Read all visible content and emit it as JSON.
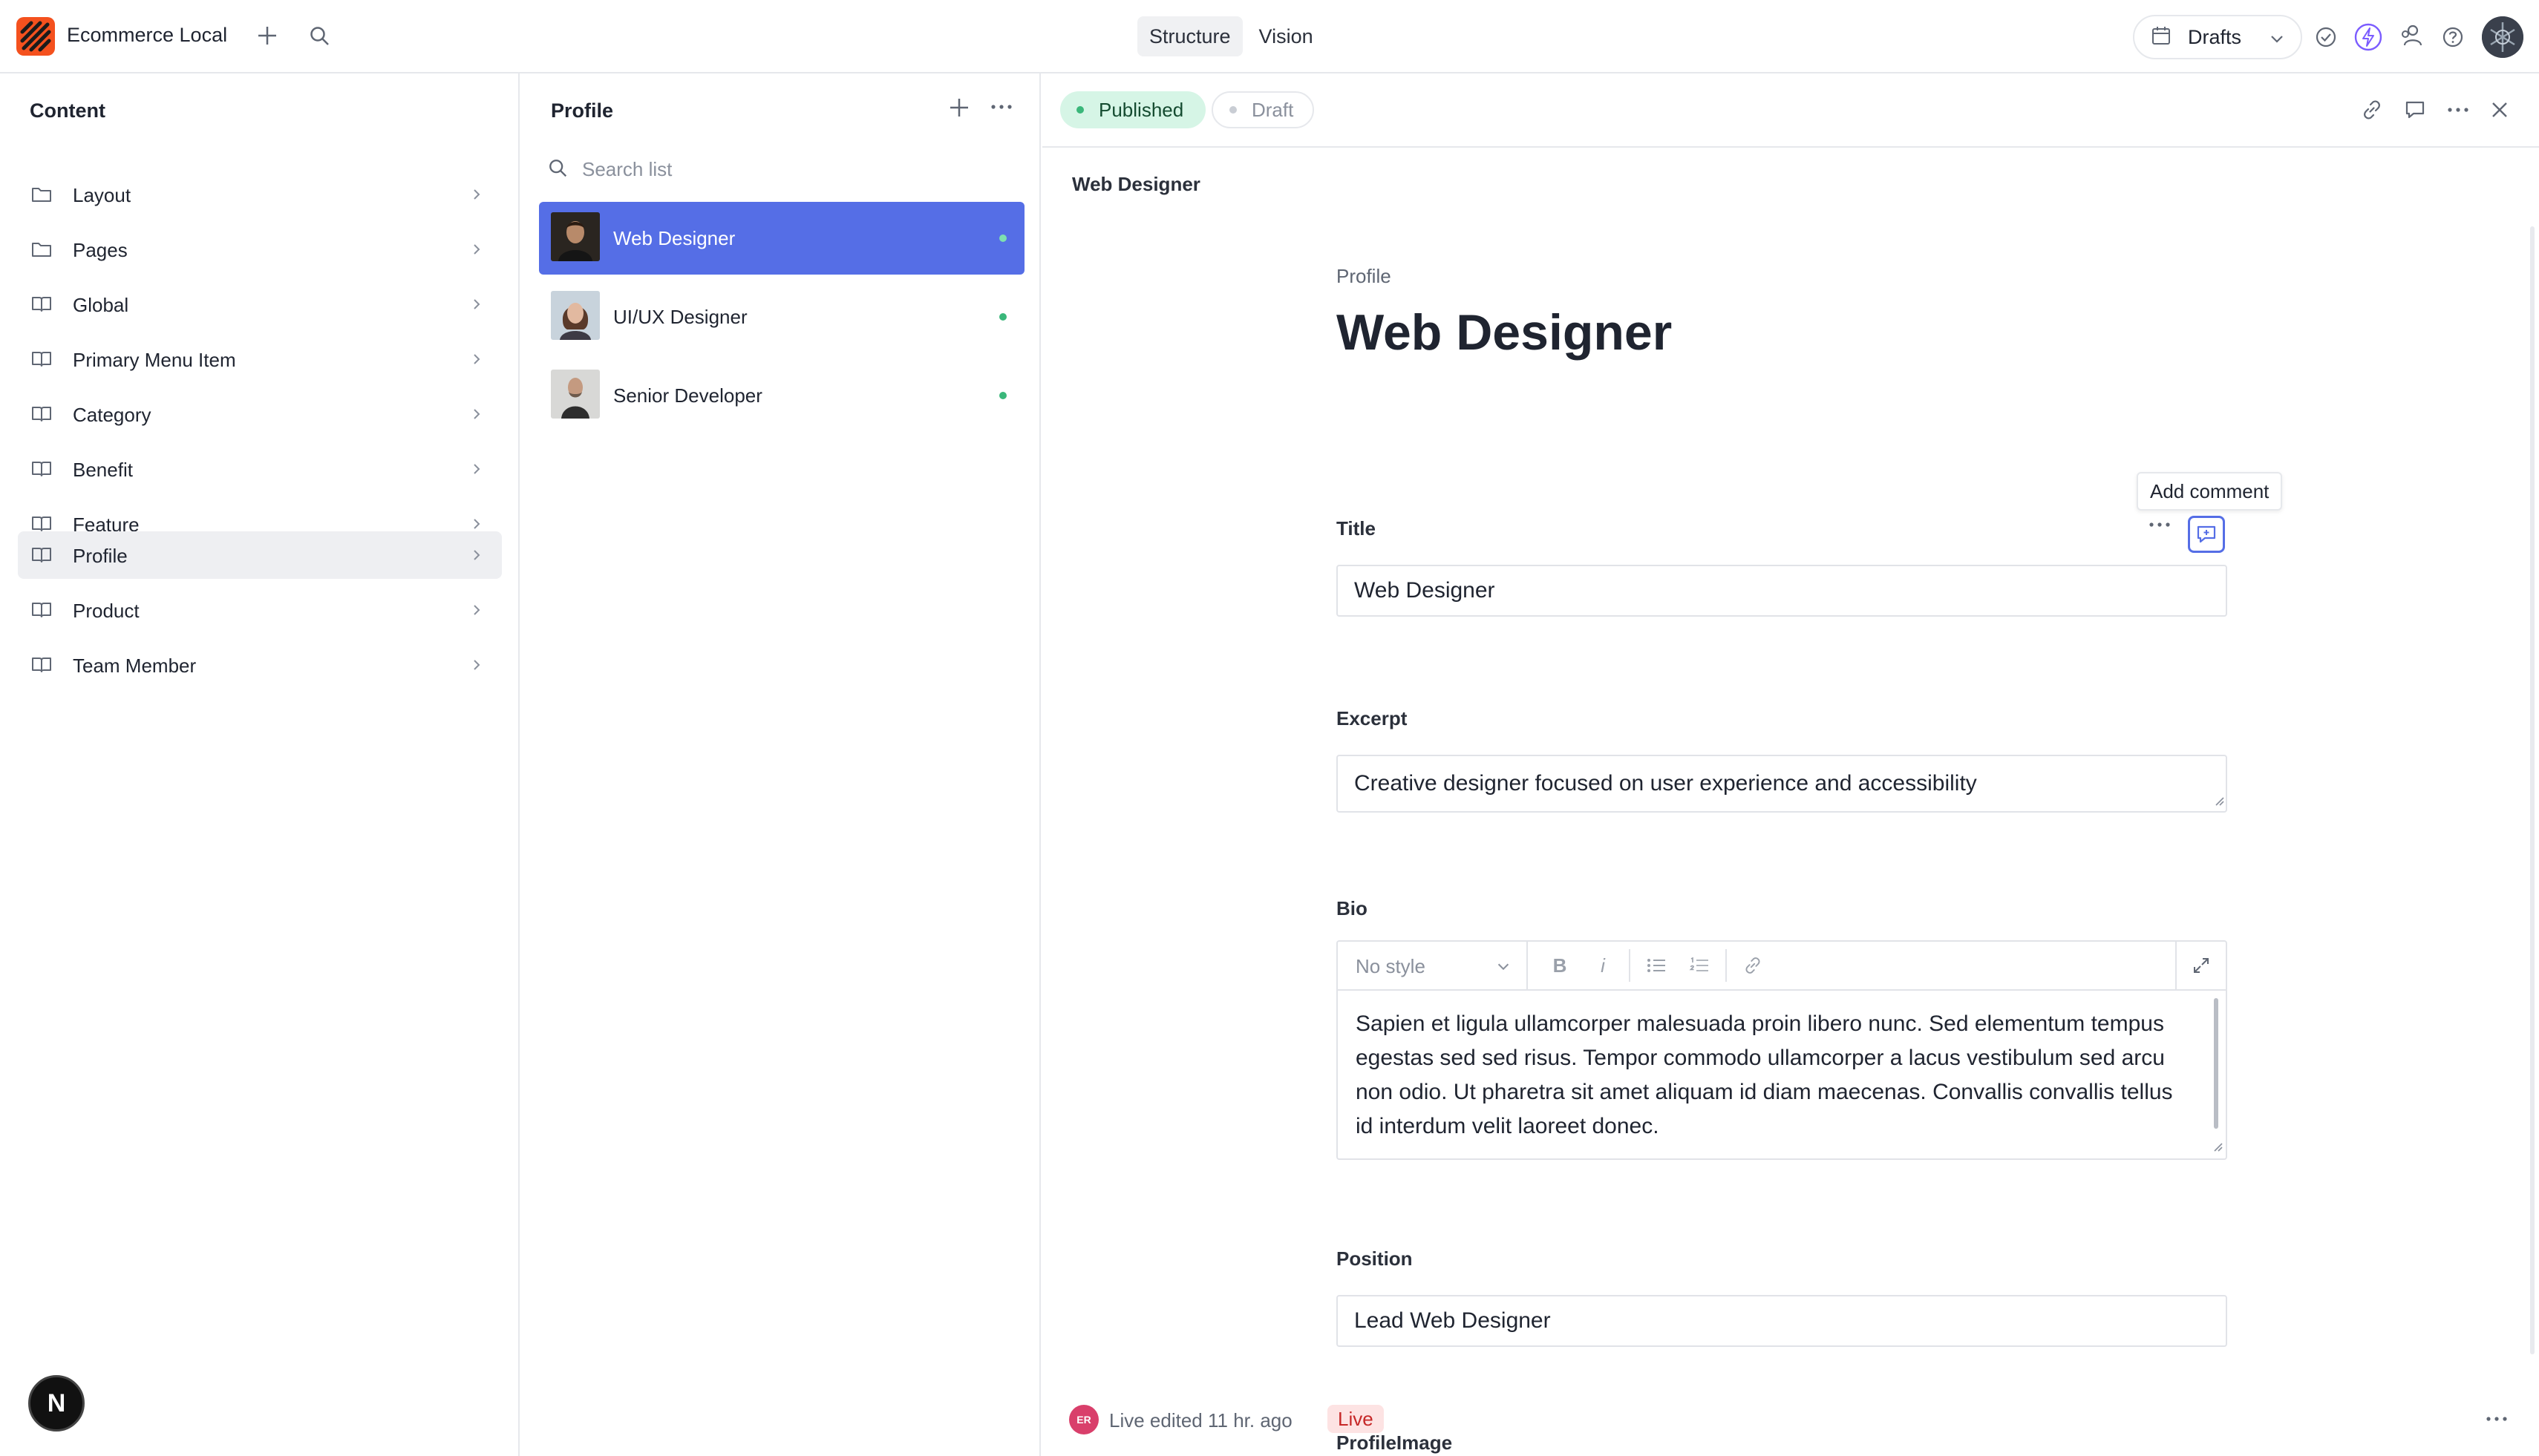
{
  "app": {
    "title": "Ecommerce Local"
  },
  "top_tabs": [
    {
      "label": "Structure",
      "active": true
    },
    {
      "label": "Vision",
      "active": false
    }
  ],
  "drafts": {
    "label": "Drafts"
  },
  "sidebar": {
    "title": "Content",
    "items": [
      {
        "label": "Layout",
        "icon": "folder-icon"
      },
      {
        "label": "Pages",
        "icon": "folder-icon"
      },
      {
        "label": "Global",
        "icon": "book-icon"
      },
      {
        "label": "Primary Menu Item",
        "icon": "book-icon"
      },
      {
        "label": "Category",
        "icon": "book-icon"
      },
      {
        "label": "Benefit",
        "icon": "book-icon"
      },
      {
        "label": "Feature",
        "icon": "book-icon"
      },
      {
        "label": "Profile",
        "icon": "book-icon",
        "active": true
      },
      {
        "label": "Product",
        "icon": "book-icon"
      },
      {
        "label": "Team Member",
        "icon": "book-icon"
      }
    ]
  },
  "list": {
    "title": "Profile",
    "search_placeholder": "Search list",
    "items": [
      {
        "label": "Web Designer",
        "active": true
      },
      {
        "label": "UI/UX Designer"
      },
      {
        "label": "Senior Developer"
      }
    ]
  },
  "document": {
    "status": {
      "published": "Published",
      "draft": "Draft"
    },
    "breadcrumb": "Web Designer",
    "type": "Profile",
    "title": "Web Designer",
    "tooltip": "Add comment",
    "fields": {
      "title": {
        "label": "Title",
        "value": "Web Designer"
      },
      "excerpt": {
        "label": "Excerpt",
        "value": "Creative designer focused on user experience and accessibility"
      },
      "bio": {
        "label": "Bio",
        "style": "No style",
        "text": "Sapien et ligula ullamcorper malesuada proin libero nunc. Sed elementum tempus egestas sed sed risus. Tempor commodo ullamcorper a lacus vestibulum sed arcu non odio. Ut pharetra sit amet aliquam id diam maecenas. Convallis convallis tellus id interdum velit laoreet donec."
      },
      "position": {
        "label": "Position",
        "value": "Lead Web Designer"
      },
      "profile_image": {
        "label": "ProfileImage"
      }
    },
    "footer": {
      "avatar": "ER",
      "text": "Live edited 11 hr. ago",
      "badge": "Live"
    }
  },
  "badge": {
    "label": "N"
  },
  "colors": {
    "accent": "#556ee6",
    "brand": "#f4511e",
    "published_bg": "#d6f5e6",
    "live_bg": "#fde3e3"
  }
}
